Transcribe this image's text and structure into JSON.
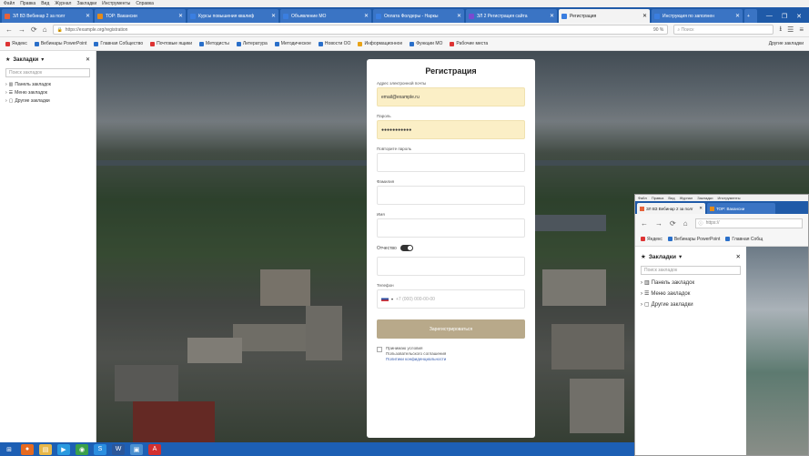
{
  "menubar": {
    "items": [
      "Файл",
      "Правка",
      "Вид",
      "Журнал",
      "Закладки",
      "Инструменты",
      "Справка"
    ]
  },
  "tabs": [
    {
      "label": "ЗЛ ВЗ Вебинар 2 за полг",
      "color": "#e6623a"
    },
    {
      "label": "ТОР: Вакансии",
      "color": "#e48b1a"
    },
    {
      "label": "Курсы повышения квалиф",
      "color": "#3a7ee0"
    },
    {
      "label": "Объявление МО",
      "color": "#3a7ee0"
    },
    {
      "label": "Оплата Фолдеры - Наркы",
      "color": "#3a7ee0"
    },
    {
      "label": "ЗЛ 2 Регистрация сайта",
      "color": "#7a4ad0"
    },
    {
      "label": "Регистрация",
      "color": "#3a7ee0",
      "active": true
    },
    {
      "label": "Инструкция по заполнен",
      "color": "#3a7ee0"
    }
  ],
  "window_controls": {
    "minimize": "—",
    "maximize": "❐",
    "close": "✕"
  },
  "nav": {
    "back": "←",
    "forward": "→",
    "reload": "⟳",
    "home": "⌂",
    "url": "https://example.org/registration",
    "zoom": "90 %",
    "search_placeholder": "Поиск"
  },
  "bookmarks": [
    {
      "label": "Яндекс",
      "color": "#d33"
    },
    {
      "label": "Вебинары PowerPoint",
      "color": "#2a6fc9"
    },
    {
      "label": "Главная Собщество",
      "color": "#2a6fc9"
    },
    {
      "label": "Почтовые ящики",
      "color": "#d33"
    },
    {
      "label": "Методисты",
      "color": "#2a6fc9"
    },
    {
      "label": "Литература",
      "color": "#2a6fc9"
    },
    {
      "label": "Методическое",
      "color": "#2a6fc9"
    },
    {
      "label": "Новости ОО",
      "color": "#2a6fc9"
    },
    {
      "label": "Информационное",
      "color": "#e8a317"
    },
    {
      "label": "Функции МО",
      "color": "#2a6fc9"
    },
    {
      "label": "Рабочие места",
      "color": "#d33"
    }
  ],
  "bookmarks_other": "Другие закладки",
  "sidebar": {
    "title": "Закладки",
    "close": "✕",
    "search_placeholder": "Поиск закладок",
    "items": [
      {
        "label": "Панель закладок"
      },
      {
        "label": "Меню закладок"
      },
      {
        "label": "Другие закладки"
      }
    ]
  },
  "form": {
    "title": "Регистрация",
    "email_label": "Адрес электронной почты",
    "email_value": "email@example.ru",
    "password_label": "Пароль",
    "password_value": "●●●●●●●●●●●",
    "repeat_label": "Повторите пароль",
    "lastname_label": "Фамилия",
    "firstname_label": "Имя",
    "patronymic_label": "Отчество",
    "phone_label": "Телефон",
    "phone_placeholder": "+7 (000) 000-00-00",
    "submit_label": "Зарегистрироваться",
    "agree_text": "Принимаю условия",
    "agree_text2": "Пользовательского соглашения",
    "agree_link": "Политики конфиденциальности"
  },
  "popup": {
    "menu": [
      "Файл",
      "Правка",
      "Вид",
      "Журнал",
      "Закладки",
      "Инструменты"
    ],
    "tab1": "ЗЛ ВЗ Вебинар 2 за полг",
    "tab2": "ТОР: Вакансии",
    "url": "https://",
    "bookmarks": [
      "Яндекс",
      "Вебинары PowerPoint",
      "Главная Собщ"
    ],
    "sidebar_title": "Закладки",
    "sidebar_close": "✕",
    "search_placeholder": "Поиск закладок",
    "items": [
      "Панель закладок",
      "Меню закладок",
      "Другие закладки"
    ]
  },
  "taskbar": {
    "items": [
      {
        "name": "start",
        "color": "#2a7de1",
        "glyph": "⊞"
      },
      {
        "name": "firefox",
        "color": "#e66a20",
        "glyph": "●"
      },
      {
        "name": "explorer",
        "color": "#e8b84a",
        "glyph": "▤"
      },
      {
        "name": "media",
        "color": "#2a9ae0",
        "glyph": "▶"
      },
      {
        "name": "chrome",
        "color": "#3aa04a",
        "glyph": "◉"
      },
      {
        "name": "skype",
        "color": "#2a8ee0",
        "glyph": "S"
      },
      {
        "name": "word",
        "color": "#2b579a",
        "glyph": "W"
      },
      {
        "name": "app",
        "color": "#4a8fd0",
        "glyph": "▣"
      },
      {
        "name": "acrobat",
        "color": "#d32f2f",
        "glyph": "A"
      }
    ]
  }
}
